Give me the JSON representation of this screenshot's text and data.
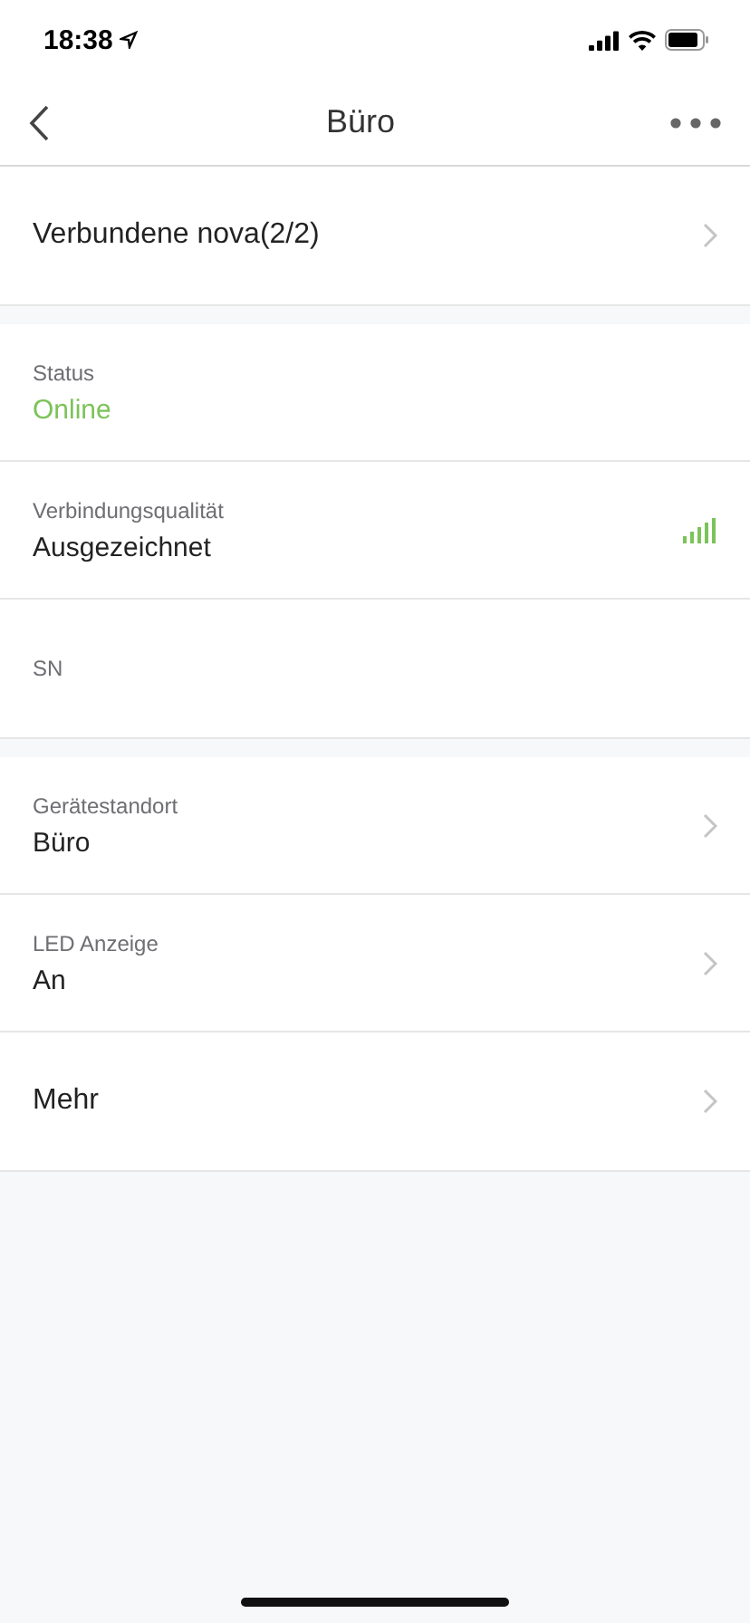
{
  "status_bar": {
    "time": "18:38"
  },
  "nav": {
    "title": "Büro"
  },
  "sections": [
    {
      "rows": [
        {
          "kind": "link",
          "title": "Verbundene nova(2/2)"
        }
      ]
    },
    {
      "rows": [
        {
          "kind": "info",
          "label": "Status",
          "value": "Online",
          "color": "#7cc35a"
        },
        {
          "kind": "signal",
          "label": "Verbindungsqualität",
          "value": "Ausgezeichnet"
        },
        {
          "kind": "info",
          "label": "SN"
        }
      ]
    },
    {
      "rows": [
        {
          "kind": "link",
          "label": "Gerätestandort",
          "value": "Büro"
        },
        {
          "kind": "link",
          "label": "LED Anzeige",
          "value": "An"
        },
        {
          "kind": "link",
          "title": "Mehr"
        }
      ]
    }
  ]
}
